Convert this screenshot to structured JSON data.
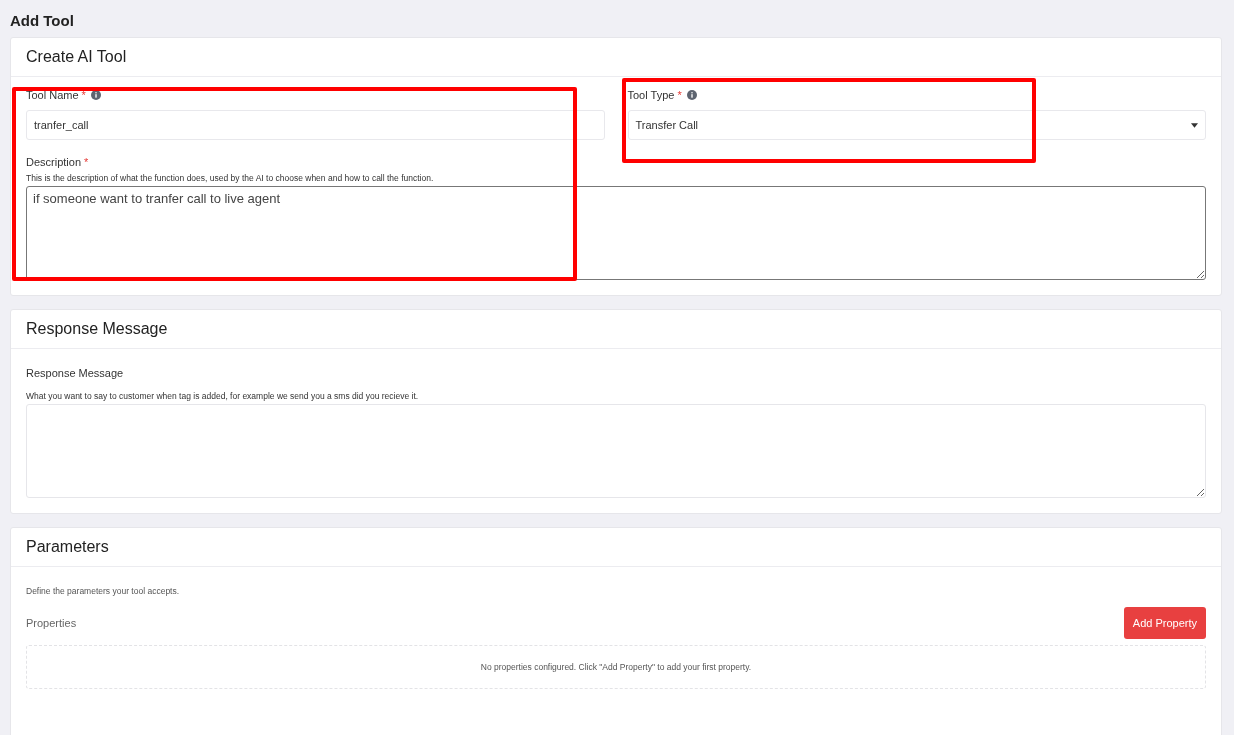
{
  "page_title": "Add Tool",
  "create_tool": {
    "title": "Create AI Tool",
    "tool_name": {
      "label": "Tool Name",
      "required_mark": "*",
      "value": "tranfer_call",
      "highlighted": true
    },
    "tool_type": {
      "label": "Tool Type",
      "required_mark": "*",
      "value": "Transfer Call",
      "highlighted": true
    },
    "description": {
      "label": "Description",
      "required_mark": "*",
      "help": "This is the description of what the function does, used by the AI to choose when and how to call the function.",
      "value": "if someone want to tranfer call to live agent"
    }
  },
  "response_message": {
    "title": "Response Message",
    "label": "Response Message",
    "help": "What you want to say to customer when tag is added, for example we send you a sms did you recieve it."
  },
  "parameters": {
    "title": "Parameters",
    "intro": "Define the parameters your tool accepts.",
    "properties_label": "Properties",
    "add_button": "Add Property",
    "empty_text": "No properties configured. Click \"Add Property\" to add your first property."
  }
}
